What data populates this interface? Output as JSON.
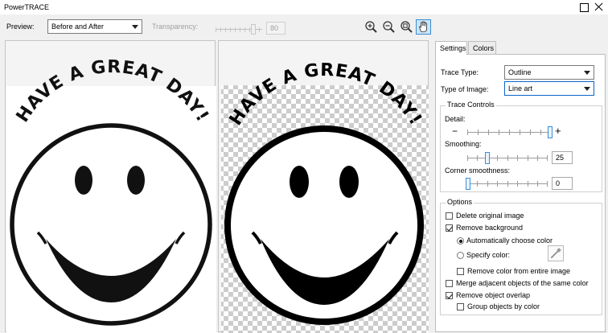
{
  "window": {
    "title": "PowerTRACE"
  },
  "toolbar": {
    "preview_label": "Preview:",
    "preview_value": "Before and After",
    "transparency_label": "Transparency:",
    "transparency_value": "80",
    "icons": [
      "zoom-in-icon",
      "zoom-out-icon",
      "zoom-fit-icon",
      "hand-pan-icon"
    ]
  },
  "preview": {
    "original_text": "HAVE A GREAT DAY!",
    "traced_text": "HAVE A GREAT DAY!"
  },
  "tabs": [
    "Settings",
    "Colors"
  ],
  "settings": {
    "trace_type_label": "Trace Type:",
    "trace_type_value": "Outline",
    "image_type_label": "Type of Image:",
    "image_type_value": "Line art",
    "trace_controls": {
      "title": "Trace Controls",
      "detail_label": "Detail:",
      "detail_minus": "−",
      "detail_plus": "+",
      "detail_level": 1.0,
      "smoothing_label": "Smoothing:",
      "smoothing_value": "25",
      "corner_label": "Corner smoothness:",
      "corner_value": "0"
    },
    "options": {
      "title": "Options",
      "delete_original": "Delete original image",
      "remove_background": "Remove background",
      "auto_color": "Automatically choose color",
      "specify_color": "Specify color:",
      "remove_color_entire": "Remove color from entire image",
      "merge_adjacent": "Merge adjacent objects of the same color",
      "remove_overlap": "Remove object overlap",
      "group_by_color": "Group objects by color"
    }
  },
  "colors": {
    "accent": "#3d8fd8",
    "checker": "#cccccc"
  }
}
